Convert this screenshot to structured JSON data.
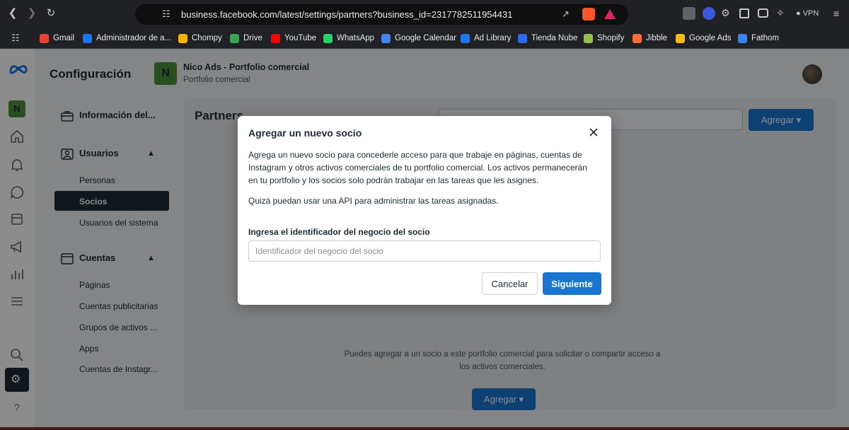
{
  "browser": {
    "url": "business.facebook.com/latest/settings/partners?business_id=2317782511954431",
    "vpn_label": "VPN",
    "bookmarks": [
      {
        "label": "Gmail",
        "color": "#ea4335"
      },
      {
        "label": "Administrador de a...",
        "color": "#1877f2"
      },
      {
        "label": "Chompy",
        "color": "#f4b400"
      },
      {
        "label": "Drive",
        "color": "#34a853"
      },
      {
        "label": "YouTube",
        "color": "#ff0000"
      },
      {
        "label": "WhatsApp",
        "color": "#25d366"
      },
      {
        "label": "Google Calendar",
        "color": "#4285f4"
      },
      {
        "label": "Ad Library",
        "color": "#1877f2"
      },
      {
        "label": "Tienda Nube",
        "color": "#2c6bed"
      },
      {
        "label": "Shopify",
        "color": "#95bf47"
      },
      {
        "label": "Jibble",
        "color": "#ff6b35"
      },
      {
        "label": "Google Ads",
        "color": "#fbbc04"
      },
      {
        "label": "Fathom",
        "color": "#3b82f6"
      }
    ]
  },
  "header": {
    "title": "Configuración",
    "business_initial": "N",
    "business_name": "Nico Ads - Portfolio comercial",
    "business_sub": "Portfolio comercial"
  },
  "rail": {
    "business_initial": "N",
    "help": "?"
  },
  "sidebar": {
    "info_label": "Información del...",
    "users_label": "Usuarios",
    "users_items": [
      "Personas",
      "Socios",
      "Usuarios del sistema"
    ],
    "accounts_label": "Cuentas",
    "accounts_items": [
      "Páginas",
      "Cuentas publicitarias",
      "Grupos de activos ...",
      "Apps",
      "Cuentas de Instagr..."
    ]
  },
  "background": {
    "title": "Partners",
    "add_label": "Agregar",
    "text": "Puedes agregar a un socio a este portfolio comercial para solicitar o compartir acceso a los activos comerciales."
  },
  "modal": {
    "title": "Agregar un nuevo socio",
    "description": "Agrega un nuevo socio para concederle acceso para que trabaje en páginas, cuentas de Instagram y otros activos comerciales de tu portfolio comercial. Los activos permanecerán en tu portfolio y los socios solo podrán trabajar en las tareas que les asignes.",
    "api_note": "Quizá puedan usar una API para administrar las tareas asignadas.",
    "field_label": "Ingresa el identificador del negocio del socio",
    "field_placeholder": "Identificador del negocio del socio",
    "field_value": "",
    "cancel_label": "Cancelar",
    "next_label": "Siguiente"
  },
  "colors": {
    "accent": "#1876d2",
    "dark": "#1c2b33"
  }
}
